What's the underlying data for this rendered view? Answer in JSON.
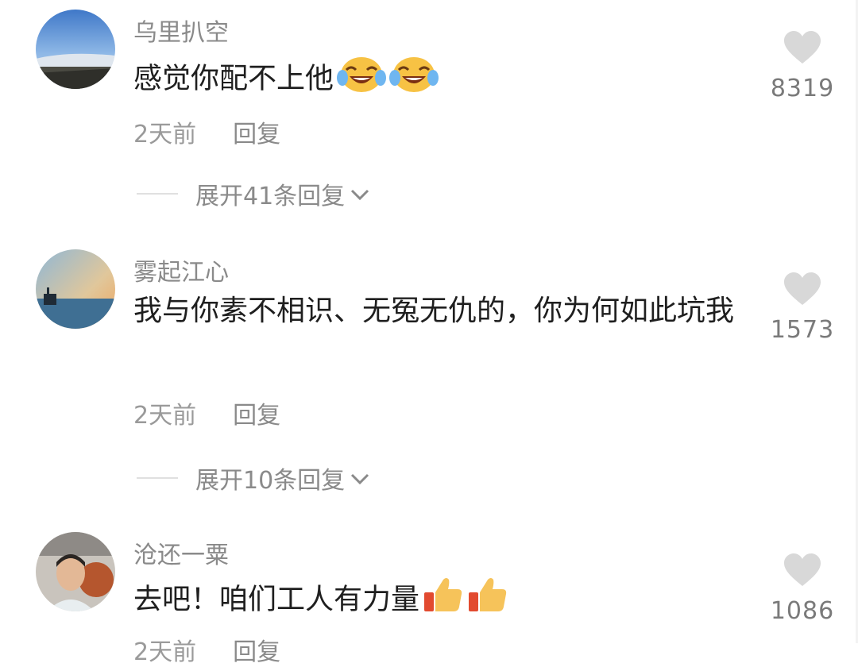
{
  "comments": [
    {
      "username": "乌里扒空",
      "text": "感觉你配不上他",
      "emoji": [
        "crying-laughing-emoji",
        "crying-laughing-emoji"
      ],
      "time": "2天前",
      "reply_label": "回复",
      "expand_label": "展开41条回复",
      "likes": "8319"
    },
    {
      "username": "雾起江心",
      "text": "我与你素不相识、无冤无仇的，你为何如此坑我",
      "time": "2天前",
      "reply_label": "回复",
      "expand_label": "展开10条回复",
      "likes": "1573"
    },
    {
      "username": "沧还一粟",
      "text": "去吧！咱们工人有力量",
      "emoji": [
        "thumbs-up-emoji",
        "thumbs-up-emoji"
      ],
      "time": "2天前",
      "reply_label": "回复",
      "likes": "1086"
    }
  ]
}
